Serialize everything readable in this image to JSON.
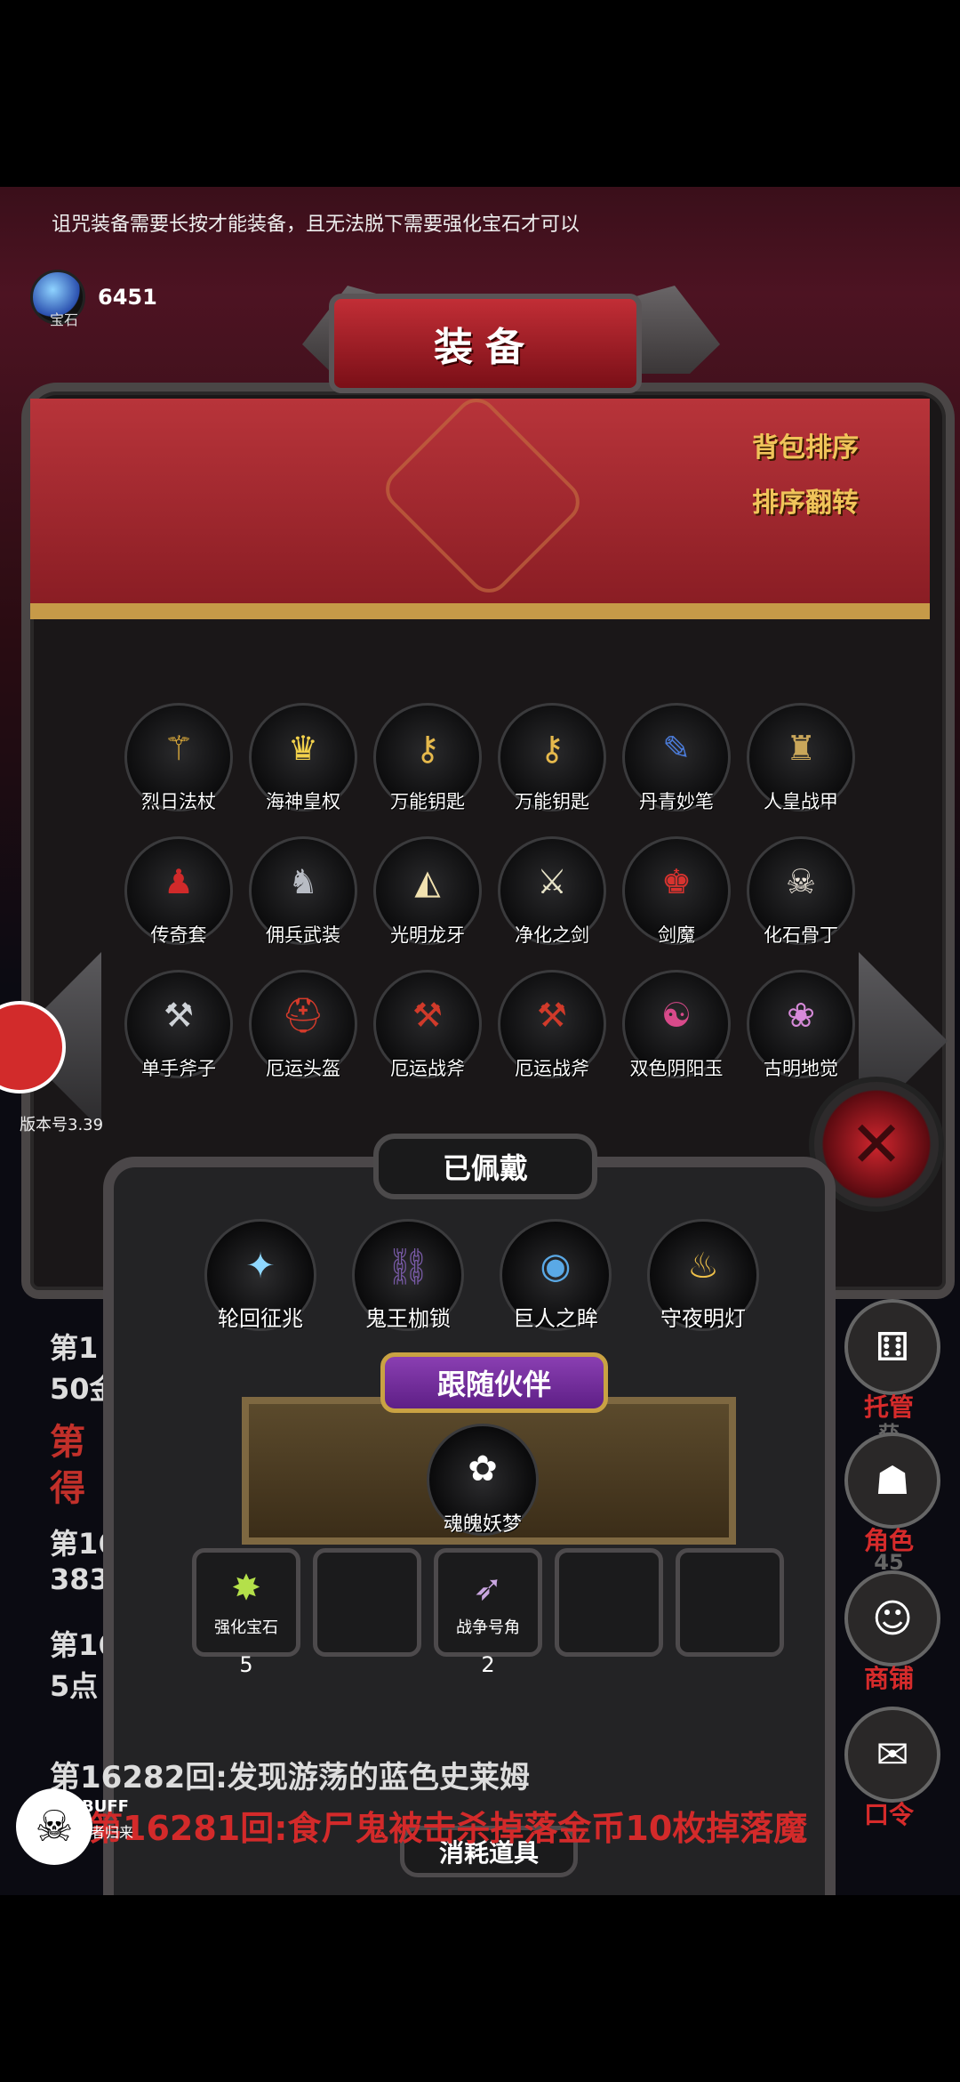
{
  "notice": "诅咒装备需要长按才能装备，且无法脱下需要强化宝石才可以",
  "gem": {
    "label": "宝石",
    "value": "6451",
    "icon": "blue-gem-icon"
  },
  "panel": {
    "title": "装备",
    "sort_button": "背包排序",
    "reverse_button": "排序翻转",
    "items": [
      {
        "label": "烈日法杖",
        "icon": "staff-icon",
        "glyph": "⚚",
        "color": "#e9b43c"
      },
      {
        "label": "海神皇权",
        "icon": "golden-armor-icon",
        "glyph": "♛",
        "color": "#f3d24b"
      },
      {
        "label": "万能钥匙",
        "icon": "key-icon",
        "glyph": "⚷",
        "color": "#e6b94c"
      },
      {
        "label": "万能钥匙",
        "icon": "key-icon",
        "glyph": "⚷",
        "color": "#e6b94c"
      },
      {
        "label": "丹青妙笔",
        "icon": "brush-icon",
        "glyph": "✎",
        "color": "#4b7bd8"
      },
      {
        "label": "人皇战甲",
        "icon": "armor-icon",
        "glyph": "♜",
        "color": "#c9a65a"
      },
      {
        "label": "传奇套",
        "icon": "red-robe-icon",
        "glyph": "♟",
        "color": "#d02a2a"
      },
      {
        "label": "佣兵武装",
        "icon": "knight-icon",
        "glyph": "♞",
        "color": "#b8bcc4"
      },
      {
        "label": "光明龙牙",
        "icon": "fang-icon",
        "glyph": "◭",
        "color": "#f2e2b0"
      },
      {
        "label": "净化之剑",
        "icon": "sword-icon",
        "glyph": "⚔",
        "color": "#e8e4c8"
      },
      {
        "label": "剑魔",
        "icon": "demon-icon",
        "glyph": "♚",
        "color": "#d8332f"
      },
      {
        "label": "化石骨丁",
        "icon": "bone-icon",
        "glyph": "☠",
        "color": "#efe7dc"
      },
      {
        "label": "单手斧子",
        "icon": "axe-icon",
        "glyph": "⚒",
        "color": "#cfd3d8"
      },
      {
        "label": "厄运头盔",
        "icon": "helmet-icon",
        "glyph": "⛑",
        "color": "#d63b2b"
      },
      {
        "label": "厄运战斧",
        "icon": "battle-axe-icon",
        "glyph": "⚒",
        "color": "#d03a2a"
      },
      {
        "label": "厄运战斧",
        "icon": "battle-axe-icon",
        "glyph": "⚒",
        "color": "#d03a2a"
      },
      {
        "label": "双色阴阳玉",
        "icon": "orbs-icon",
        "glyph": "☯",
        "color": "#d84a8a"
      },
      {
        "label": "古明地觉",
        "icon": "girl-icon",
        "glyph": "❀",
        "color": "#d78ad9"
      }
    ]
  },
  "version": "版本号3.39",
  "equipped": {
    "title": "已佩戴",
    "items": [
      {
        "label": "轮回征兆",
        "icon": "ice-staff-icon",
        "glyph": "✦",
        "color": "#8fd8ff"
      },
      {
        "label": "鬼王枷锁",
        "icon": "chain-icon",
        "glyph": "⛓",
        "color": "#7a5ba8"
      },
      {
        "label": "巨人之眸",
        "icon": "eye-icon",
        "glyph": "◉",
        "color": "#5aa9e6"
      },
      {
        "label": "守夜明灯",
        "icon": "lantern-icon",
        "glyph": "♨",
        "color": "#f1c24a"
      }
    ]
  },
  "companion": {
    "title": "跟随伙伴",
    "name": "魂魄妖梦",
    "icon": "companion-icon",
    "glyph": "✿",
    "color": "#9be39b"
  },
  "consumables": {
    "title": "消耗道具",
    "slots": [
      {
        "label": "强化宝石",
        "count": "5",
        "icon": "green-gem-icon",
        "glyph": "✸",
        "color": "#b4e04a"
      },
      {
        "label": "",
        "count": "",
        "icon": "",
        "glyph": "",
        "color": ""
      },
      {
        "label": "战争号角",
        "count": "2",
        "icon": "horn-icon",
        "glyph": "➶",
        "color": "#c9a6e0"
      },
      {
        "label": "",
        "count": "",
        "icon": "",
        "glyph": "",
        "color": ""
      },
      {
        "label": "",
        "count": "",
        "icon": "",
        "glyph": "",
        "color": ""
      }
    ]
  },
  "log": {
    "line_a1": "第1",
    "line_a2": "50金",
    "line_b": "第",
    "line_c": "得",
    "line_d1": "第16",
    "line_d2": "383",
    "line_e1": "第16",
    "line_e2": "5点",
    "line_f": "第16282回:发现游荡的蓝色史莱姆",
    "line_g": "第16281回:食尸鬼被击杀掉落金币10枚掉落魔"
  },
  "right_buttons": [
    {
      "label": "托管",
      "sub": "获",
      "icon": "dice-icon",
      "glyph": "⚅"
    },
    {
      "label": "角色",
      "sub": "45",
      "icon": "hooded-figure-icon",
      "glyph": "☗"
    },
    {
      "label": "商铺",
      "sub": "",
      "icon": "merchant-icon",
      "glyph": "☺"
    },
    {
      "label": "口令",
      "sub": "",
      "icon": "book-icon",
      "glyph": "✉"
    }
  ],
  "buff": {
    "label": "BUFF",
    "sub": "亡者归来",
    "icon": "skull-icon",
    "glyph": "☠"
  },
  "close_glyph": "✕"
}
